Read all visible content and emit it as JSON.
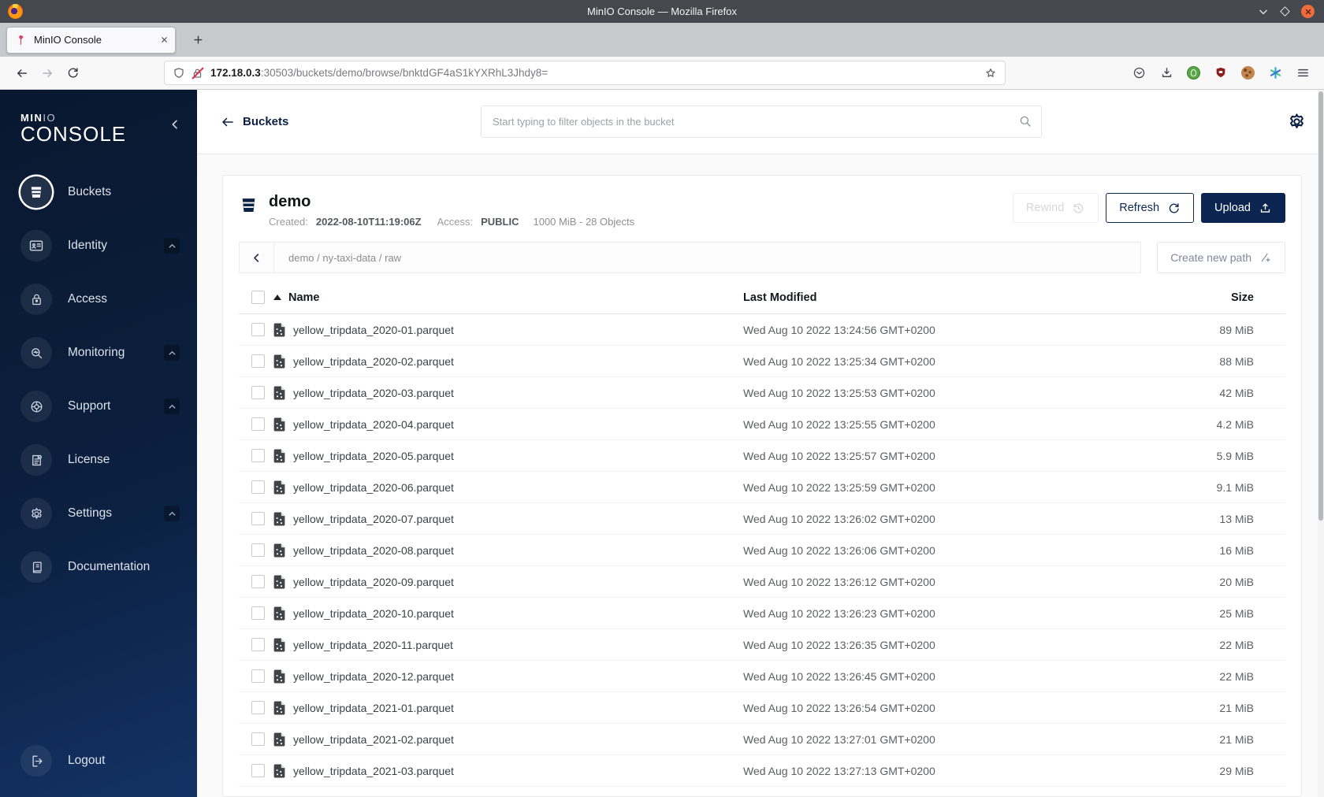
{
  "window": {
    "title": "MinIO Console — Mozilla Firefox"
  },
  "browser": {
    "tab_title": "MinIO Console",
    "url": {
      "host": "172.18.0.3",
      "rest": ":30503/buckets/demo/browse/bnktdGF4aS1kYXRhL3Jhdy8="
    }
  },
  "sidebar": {
    "logo_min": "MIN",
    "logo_io": "IO",
    "logo_console": "CONSOLE",
    "items": [
      {
        "label": "Buckets",
        "active": true,
        "expandable": false
      },
      {
        "label": "Identity",
        "active": false,
        "expandable": true
      },
      {
        "label": "Access",
        "active": false,
        "expandable": false
      },
      {
        "label": "Monitoring",
        "active": false,
        "expandable": true
      },
      {
        "label": "Support",
        "active": false,
        "expandable": true
      },
      {
        "label": "License",
        "active": false,
        "expandable": false
      },
      {
        "label": "Settings",
        "active": false,
        "expandable": true
      },
      {
        "label": "Documentation",
        "active": false,
        "expandable": false
      }
    ],
    "logout_label": "Logout"
  },
  "topbar": {
    "back_label": "Buckets",
    "search_placeholder": "Start typing to filter objects in the bucket"
  },
  "bucket": {
    "name": "demo",
    "created_label": "Created:",
    "created_value": "2022-08-10T11:19:06Z",
    "access_label": "Access:",
    "access_value": "PUBLIC",
    "usage": "1000 MiB - 28 Objects",
    "rewind_label": "Rewind",
    "refresh_label": "Refresh",
    "upload_label": "Upload"
  },
  "browse": {
    "breadcrumb": "demo / ny-taxi-data / raw",
    "create_path_label": "Create new path"
  },
  "table": {
    "columns": {
      "name": "Name",
      "modified": "Last Modified",
      "size": "Size"
    },
    "rows": [
      {
        "name": "yellow_tripdata_2020-01.parquet",
        "modified": "Wed Aug 10 2022 13:24:56 GMT+0200",
        "size": "89 MiB"
      },
      {
        "name": "yellow_tripdata_2020-02.parquet",
        "modified": "Wed Aug 10 2022 13:25:34 GMT+0200",
        "size": "88 MiB"
      },
      {
        "name": "yellow_tripdata_2020-03.parquet",
        "modified": "Wed Aug 10 2022 13:25:53 GMT+0200",
        "size": "42 MiB"
      },
      {
        "name": "yellow_tripdata_2020-04.parquet",
        "modified": "Wed Aug 10 2022 13:25:55 GMT+0200",
        "size": "4.2 MiB"
      },
      {
        "name": "yellow_tripdata_2020-05.parquet",
        "modified": "Wed Aug 10 2022 13:25:57 GMT+0200",
        "size": "5.9 MiB"
      },
      {
        "name": "yellow_tripdata_2020-06.parquet",
        "modified": "Wed Aug 10 2022 13:25:59 GMT+0200",
        "size": "9.1 MiB"
      },
      {
        "name": "yellow_tripdata_2020-07.parquet",
        "modified": "Wed Aug 10 2022 13:26:02 GMT+0200",
        "size": "13 MiB"
      },
      {
        "name": "yellow_tripdata_2020-08.parquet",
        "modified": "Wed Aug 10 2022 13:26:06 GMT+0200",
        "size": "16 MiB"
      },
      {
        "name": "yellow_tripdata_2020-09.parquet",
        "modified": "Wed Aug 10 2022 13:26:12 GMT+0200",
        "size": "20 MiB"
      },
      {
        "name": "yellow_tripdata_2020-10.parquet",
        "modified": "Wed Aug 10 2022 13:26:23 GMT+0200",
        "size": "25 MiB"
      },
      {
        "name": "yellow_tripdata_2020-11.parquet",
        "modified": "Wed Aug 10 2022 13:26:35 GMT+0200",
        "size": "22 MiB"
      },
      {
        "name": "yellow_tripdata_2020-12.parquet",
        "modified": "Wed Aug 10 2022 13:26:45 GMT+0200",
        "size": "22 MiB"
      },
      {
        "name": "yellow_tripdata_2021-01.parquet",
        "modified": "Wed Aug 10 2022 13:26:54 GMT+0200",
        "size": "21 MiB"
      },
      {
        "name": "yellow_tripdata_2021-02.parquet",
        "modified": "Wed Aug 10 2022 13:27:01 GMT+0200",
        "size": "21 MiB"
      },
      {
        "name": "yellow_tripdata_2021-03.parquet",
        "modified": "Wed Aug 10 2022 13:27:13 GMT+0200",
        "size": "29 MiB"
      }
    ]
  },
  "colors": {
    "accent": "#0B2550",
    "sidebar_top": "#091830",
    "sidebar_bottom": "#133264",
    "close_button": "#EE6B3B"
  }
}
